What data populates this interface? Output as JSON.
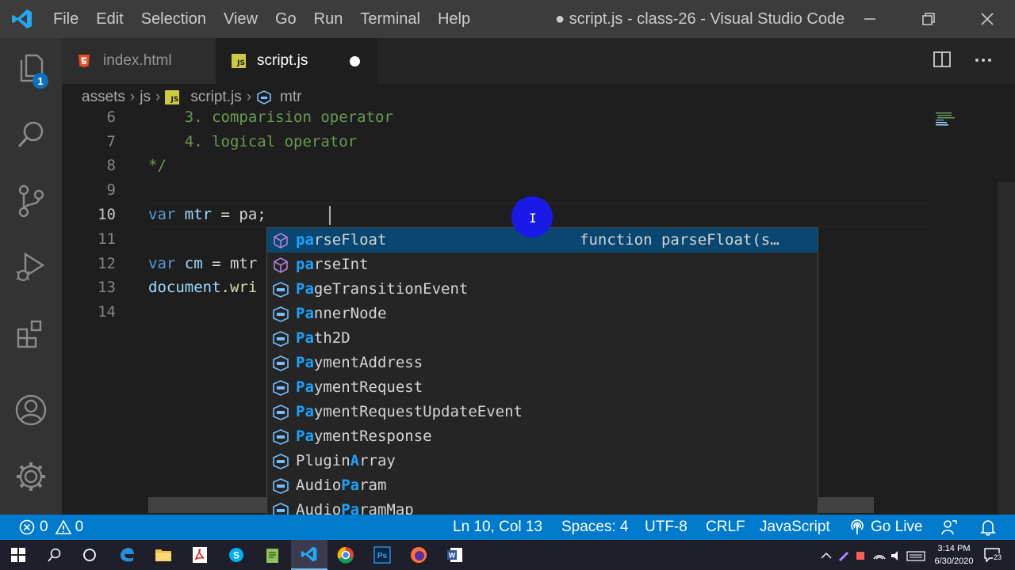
{
  "titlebar": {
    "menu": [
      "File",
      "Edit",
      "Selection",
      "View",
      "Go",
      "Run",
      "Terminal",
      "Help"
    ],
    "title": "● script.js - class-26 - Visual Studio Code"
  },
  "activitybar": {
    "explorer_badge": "1",
    "icons": [
      "files-icon",
      "search-icon",
      "source-control-icon",
      "run-debug-icon",
      "extensions-icon",
      "account-icon",
      "settings-gear-icon"
    ]
  },
  "tabs": [
    {
      "label": "index.html",
      "icon": "html5-icon",
      "active": false
    },
    {
      "label": "script.js",
      "icon": "js-icon",
      "active": true,
      "dirty": true
    }
  ],
  "tab_badges": {
    "js": "JS"
  },
  "breadcrumb": {
    "parts": [
      "assets",
      "js",
      "script.js",
      "mtr"
    ]
  },
  "editor": {
    "lines": [
      {
        "num": "6",
        "text": "    3. comparision operator"
      },
      {
        "num": "7",
        "text": "    4. logical operator"
      },
      {
        "num": "8",
        "text": "*/"
      },
      {
        "num": "9",
        "text": ""
      },
      {
        "num": "10",
        "kw": "var",
        "name": "mtr",
        "rest": " = pa;"
      },
      {
        "num": "11",
        "text": ""
      },
      {
        "num": "12",
        "kw": "var",
        "name": "cm",
        "rest": " = mtr"
      },
      {
        "num": "13",
        "obj": "document",
        "rest": ".wri"
      },
      {
        "num": "14",
        "text": ""
      }
    ]
  },
  "suggest": {
    "detail": "function parseFloat(s…",
    "items": [
      {
        "hl": "pa",
        "rest": "rseFloat",
        "kind": "method"
      },
      {
        "hl": "pa",
        "rest": "rseInt",
        "kind": "method"
      },
      {
        "hl": "Pa",
        "rest": "geTransitionEvent",
        "kind": "variable"
      },
      {
        "hl": "Pa",
        "rest": "nnerNode",
        "kind": "variable"
      },
      {
        "hl": "Pa",
        "rest": "th2D",
        "kind": "variable"
      },
      {
        "hl": "Pa",
        "rest": "ymentAddress",
        "kind": "variable"
      },
      {
        "hl": "Pa",
        "rest": "ymentRequest",
        "kind": "variable"
      },
      {
        "hl": "Pa",
        "rest": "ymentRequestUpdateEvent",
        "kind": "variable"
      },
      {
        "hl": "Pa",
        "rest": "ymentResponse",
        "kind": "variable"
      },
      {
        "pre": "Plugin",
        "hl": "A",
        "rest": "rray",
        "kind": "variable",
        "custom": true
      },
      {
        "pre": "Audio",
        "hl": "Pa",
        "rest": "ram",
        "kind": "variable",
        "custom": true
      },
      {
        "pre": "Audio",
        "hl": "Pa",
        "rest": "ramMap",
        "kind": "variable",
        "custom": true
      }
    ]
  },
  "statusbar": {
    "errors": "0",
    "warnings": "0",
    "position": "Ln 10, Col 13",
    "spaces": "Spaces: 4",
    "encoding": "UTF-8",
    "eol": "CRLF",
    "language": "JavaScript",
    "golive": "Go Live"
  },
  "taskbar": {
    "time": "3:14 PM",
    "date": "6/30/2020",
    "notifications": "23"
  },
  "colors": {
    "accent": "#007acc",
    "match_highlight": "#18a3ff",
    "selected_row": "#094771"
  }
}
